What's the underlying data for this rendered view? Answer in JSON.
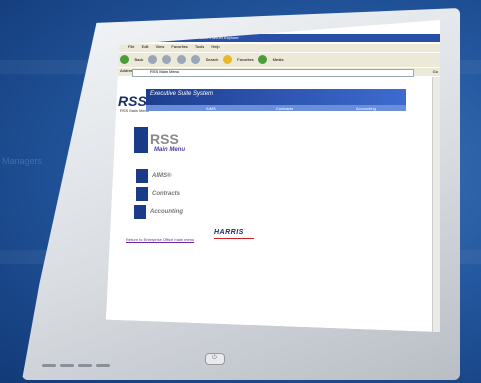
{
  "background": {
    "word": "Managers"
  },
  "browser": {
    "title": "Enterprise Office - RSS Main Menu - Microsoft Internet Explorer",
    "menus": [
      "File",
      "Edit",
      "View",
      "Favorites",
      "Tools",
      "Help"
    ],
    "toolbar": {
      "back_label": "Back",
      "search_label": "Search",
      "favorites_label": "Favorites",
      "media_label": "Media"
    },
    "address": {
      "label": "Address",
      "value": "RSS Main Menu"
    },
    "go_label": "Go"
  },
  "page": {
    "logo": "RSS",
    "logo_subtitle": "RSS Main Menu",
    "banner_title": "Executive Suite System",
    "banner_nav": [
      "AIMS",
      "Contracts",
      "Accounting"
    ],
    "main_title": "RSS",
    "main_subtitle": "Main Menu",
    "items": [
      {
        "label": "AIMS®"
      },
      {
        "label": "Contracts"
      },
      {
        "label": "Accounting"
      }
    ],
    "portal_link": "Return to Enterprise Office main menu",
    "brand": "HARRIS"
  },
  "colors": {
    "banner": "#1e3e8e",
    "link": "#6a2aa0",
    "brand": "#1b2f6a"
  }
}
